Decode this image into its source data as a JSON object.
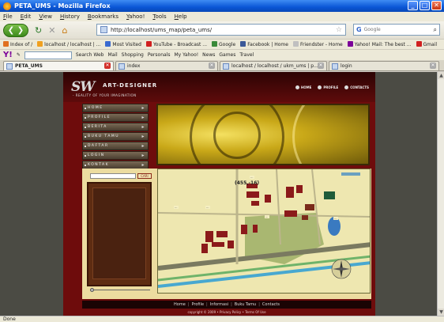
{
  "window": {
    "title": "PETA_UMS - Mozilla Firefox",
    "buttons": [
      "_",
      "□",
      "✕"
    ]
  },
  "menu": [
    "File",
    "Edit",
    "View",
    "History",
    "Bookmarks",
    "Yahoo!",
    "Tools",
    "Help"
  ],
  "nav": {
    "url": "http://localhost/ums_map/peta_ums/",
    "search_engine": "G",
    "search_placeholder": "Google"
  },
  "bookmarks": [
    {
      "label": "Index of /",
      "color": "#e07020"
    },
    {
      "label": "localhost / localhost | ...",
      "color": "#f0a020"
    },
    {
      "label": "Most Visited",
      "color": "#3a6ad0"
    },
    {
      "label": "YouTube - Broadcast ...",
      "color": "#d02020"
    },
    {
      "label": "Google",
      "color": "#3a8a3a"
    },
    {
      "label": "Facebook | Home",
      "color": "#3b5998"
    },
    {
      "label": "Friendster - Home",
      "color": "#c0c0c0"
    },
    {
      "label": "Yahoo! Mail: The best ...",
      "color": "#7b0099"
    },
    {
      "label": "Gmail",
      "color": "#d02020"
    }
  ],
  "yahoo_toolbar": {
    "logo": "Y!",
    "items": [
      "Search Web",
      "Mail",
      "Shopping",
      "Personals",
      "My Yahoo!",
      "News",
      "Games",
      "Travel"
    ]
  },
  "tabs": [
    {
      "label": "PETA_UMS",
      "active": true
    },
    {
      "label": "index",
      "active": false
    },
    {
      "label": "localhost / localhost / ukm_ums | p...",
      "active": false
    },
    {
      "label": "login",
      "active": false
    }
  ],
  "site": {
    "logo_mark": "SW",
    "logo_name": "ART-DESIGNER",
    "logo_tag": "- REALITY OF YOUR IMAGINATION",
    "top_nav": [
      "HOME",
      "PROFILE",
      "CONTACTS"
    ],
    "side_nav": [
      "HOME",
      "PROFILE",
      "BERITA",
      "BUKU TAMU",
      "DAFTAR",
      "LOGIN",
      "KONTAK"
    ],
    "search_button": "CARI",
    "coordinates": "(455,-16)",
    "footer_links": [
      "Home",
      "Profile",
      "Informasi",
      "Buku Tamu",
      "Contacts"
    ],
    "copyright": "copyright © 2009 • Privacy Policy • Terms Of Use"
  },
  "status": "Done"
}
